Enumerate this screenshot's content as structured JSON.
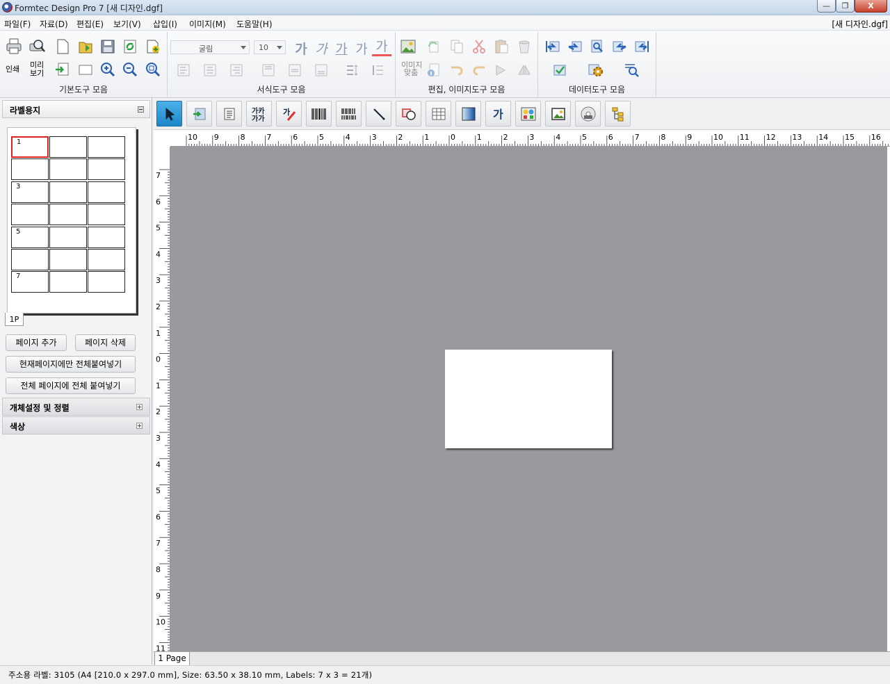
{
  "window": {
    "title": "Formtec Design Pro 7 [새 디자인.dgf]",
    "minimize": "—",
    "restore": "❐",
    "close": "X"
  },
  "menu": {
    "items": [
      "파일(F)",
      "자료(D)",
      "편집(E)",
      "보기(V)",
      "삽입(I)",
      "이미지(M)",
      "도움말(H)"
    ],
    "right_title": "[새 디자인.dgf]"
  },
  "ribbon": {
    "groups": {
      "basic": "기본도구 모음",
      "format": "서식도구 모음",
      "edit": "편집, 이미지도구 모음",
      "data": "데이터도구 모음"
    },
    "print_label": "인쇄",
    "preview_label_1": "미리",
    "preview_label_2": "보기",
    "font_value": "굴림",
    "size_value": "10",
    "format_glyph": "가",
    "image_align_1": "이미지",
    "image_align_2": "맞춤"
  },
  "left_panel": {
    "title": "라벨용지",
    "cell_numbers": [
      "1",
      "3",
      "5",
      "7"
    ],
    "page_tab": "1P",
    "add_page": "페이지 추가",
    "delete_page": "페이지 삭제",
    "paste_current": "현재페이지에만 전체붙여넣기",
    "paste_all": "전체 페이지에 전체 붙여넣기",
    "section_object": "개체설정 및 정렬",
    "section_color": "색상"
  },
  "ruler": {
    "top": [
      "10",
      "9",
      "8",
      "7",
      "6",
      "5",
      "4",
      "3",
      "2",
      "1",
      "0",
      "1",
      "2",
      "3",
      "4",
      "5",
      "6",
      "7",
      "8",
      "9",
      "10",
      "11",
      "12",
      "13",
      "14",
      "15",
      "16"
    ],
    "left": [
      "7",
      "6",
      "5",
      "4",
      "3",
      "2",
      "1",
      "0",
      "1",
      "2",
      "3",
      "4",
      "5",
      "6",
      "7",
      "8",
      "9",
      "10",
      "11"
    ]
  },
  "canvas": {
    "page_tab": "1 Page"
  },
  "status": {
    "text": "주소용 라벨: 3105 (A4 [210.0 x 297.0 mm], Size: 63.50 x 38.10 mm,  Labels: 7 x 3 = 21개)"
  },
  "colors": {
    "workspace": "#999a9e",
    "active_tool": "#2a92d4",
    "selected_cell": "#dd2222"
  }
}
